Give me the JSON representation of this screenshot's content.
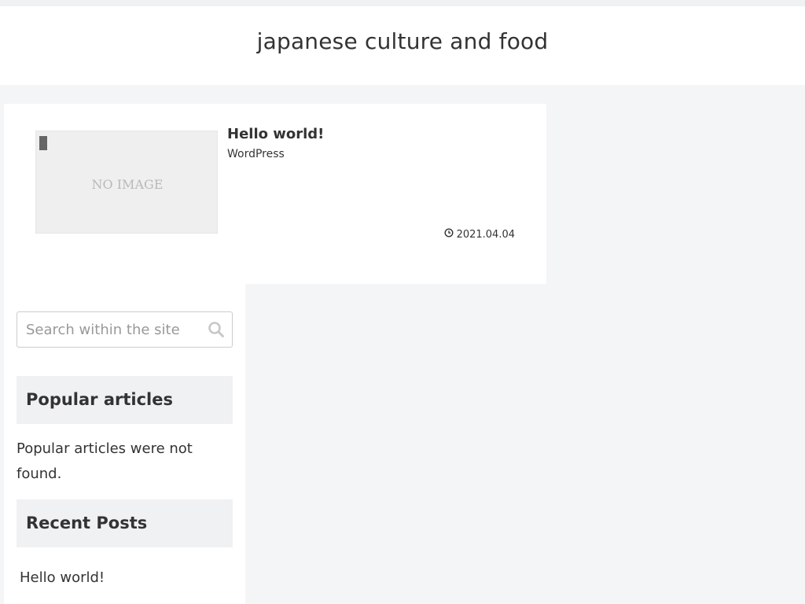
{
  "header": {
    "site_title": "japanese culture and food"
  },
  "main": {
    "entries": [
      {
        "thumbnail_text": "NO IMAGE",
        "title": "Hello world!",
        "snippet": "WordPress",
        "date": "2021.04.04",
        "date_icon": "clock-icon"
      }
    ]
  },
  "sidebar": {
    "search": {
      "placeholder": "Search within the site",
      "value": "",
      "icon": "search-icon"
    },
    "popular": {
      "heading": "Popular articles",
      "empty_message": "Popular articles were not found."
    },
    "recent": {
      "heading": "Recent Posts",
      "items": [
        "Hello world!"
      ]
    }
  },
  "colors": {
    "page_bg": "#f4f5f7",
    "card_bg": "#ffffff",
    "widget_head_bg": "#f0f1f3",
    "text": "#333333"
  }
}
